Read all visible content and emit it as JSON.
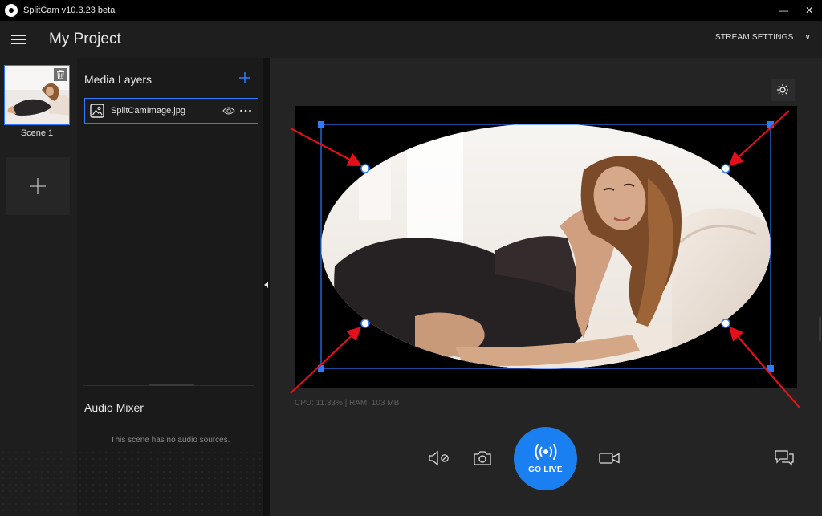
{
  "window": {
    "title": "SplitCam v10.3.23 beta",
    "minimize": "—",
    "close": "✕"
  },
  "header": {
    "project_title": "My Project",
    "stream_settings": "STREAM SETTINGS",
    "stream_chevron": "∨"
  },
  "scenes": {
    "items": [
      {
        "label": "Scene 1",
        "selected": true
      }
    ]
  },
  "layers": {
    "title": "Media Layers",
    "items": [
      {
        "name": "SplitCamImage.jpg",
        "icon": "image-icon",
        "visible": true
      }
    ]
  },
  "audio_mixer": {
    "title": "Audio Mixer",
    "empty_text": "This scene has no audio sources."
  },
  "preview": {
    "stats": "CPU: 11.33% | RAM: 103 MB"
  },
  "controls": {
    "go_live": "GO LIVE"
  },
  "colors": {
    "accent": "#1a7ff0",
    "selection": "#2c7cff",
    "annotation_arrow": "#e3101b",
    "background": "#1b1b1b"
  }
}
